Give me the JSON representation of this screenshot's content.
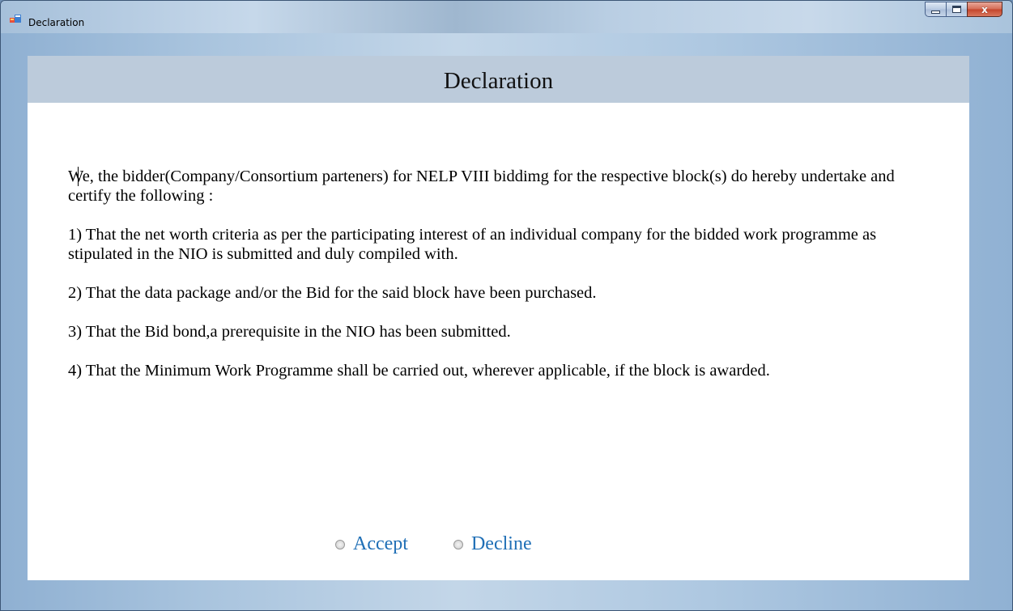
{
  "window": {
    "title": "Declaration",
    "close_glyph": "x",
    "icons": [
      "app-form-icon",
      "minimize-icon",
      "maximize-icon",
      "close-icon"
    ]
  },
  "header": {
    "title": "Declaration"
  },
  "declaration": {
    "intro": "We, the bidder(Company/Consortium parteners) for NELP VIII biddimg for the respective block(s) do hereby undertake and certify the following :",
    "items": [
      "1) That the net worth criteria as per the participating interest of an individual company for the bidded work programme as stipulated in the NIO is submitted and duly compiled with.",
      "2) That the data package and/or the Bid for the said block have been purchased.",
      "3) That the Bid bond,a prerequisite in the NIO has been submitted.",
      "4) That the Minimum Work Programme shall be carried out, wherever applicable, if the block is awarded."
    ]
  },
  "options": {
    "accept_label": "Accept",
    "decline_label": "Decline",
    "selected": null
  },
  "colors": {
    "header_band": "#bccbdb",
    "option_text": "#1f6fb6",
    "close_button": "#c4442a"
  }
}
